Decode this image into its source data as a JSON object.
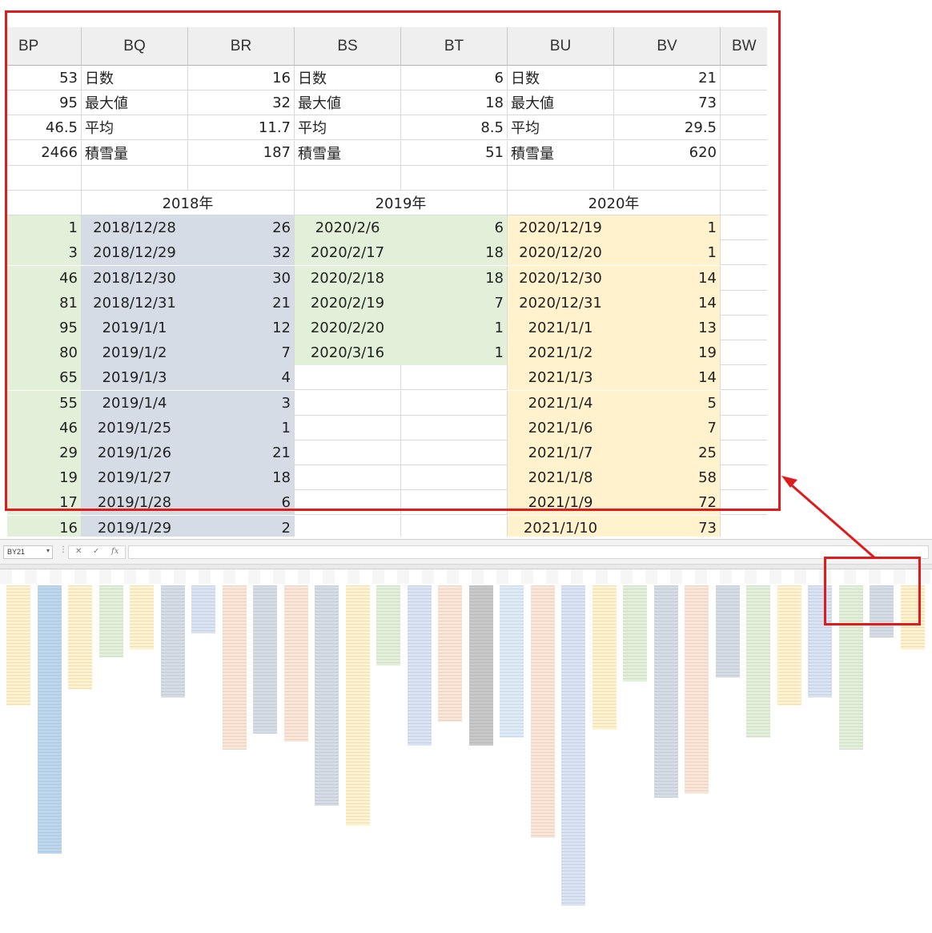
{
  "zoom_grid": {
    "columns": [
      "BP",
      "BQ",
      "BR",
      "BS",
      "BT",
      "BU",
      "BV",
      "BW"
    ],
    "summary_rows": [
      [
        "53",
        "日数",
        "16",
        "日数",
        "6",
        "日数",
        "21"
      ],
      [
        "95",
        "最大値",
        "32",
        "最大値",
        "18",
        "最大値",
        "73"
      ],
      [
        "46.5",
        "平均",
        "11.7",
        "平均",
        "8.5",
        "平均",
        "29.5"
      ],
      [
        "2466",
        "積雪量",
        "187",
        "積雪量",
        "51",
        "積雪量",
        "620"
      ]
    ],
    "year_headers": [
      "2018年",
      "2019年",
      "2020年"
    ],
    "data_rows": [
      [
        "1",
        "2018/12/28",
        "26",
        "2020/2/6",
        "6",
        "2020/12/19",
        "1"
      ],
      [
        "3",
        "2018/12/29",
        "32",
        "2020/2/17",
        "18",
        "2020/12/20",
        "1"
      ],
      [
        "46",
        "2018/12/30",
        "30",
        "2020/2/18",
        "18",
        "2020/12/30",
        "14"
      ],
      [
        "81",
        "2018/12/31",
        "21",
        "2020/2/19",
        "7",
        "2020/12/31",
        "14"
      ],
      [
        "95",
        "2019/1/1",
        "12",
        "2020/2/20",
        "1",
        "2021/1/1",
        "13"
      ],
      [
        "80",
        "2019/1/2",
        "7",
        "2020/3/16",
        "1",
        "2021/1/2",
        "19"
      ],
      [
        "65",
        "2019/1/3",
        "4",
        "",
        "",
        "2021/1/3",
        "14"
      ],
      [
        "55",
        "2019/1/4",
        "3",
        "",
        "",
        "2021/1/4",
        "5"
      ],
      [
        "46",
        "2019/1/25",
        "1",
        "",
        "",
        "2021/1/6",
        "7"
      ],
      [
        "29",
        "2019/1/26",
        "21",
        "",
        "",
        "2021/1/7",
        "25"
      ],
      [
        "19",
        "2019/1/27",
        "18",
        "",
        "",
        "2021/1/8",
        "58"
      ],
      [
        "17",
        "2019/1/28",
        "6",
        "",
        "",
        "2021/1/9",
        "72"
      ],
      [
        "16",
        "2019/1/29",
        "2",
        "",
        "",
        "2021/1/10",
        "73"
      ]
    ],
    "colors": {
      "green": "#e2efd9",
      "blue_gray": "#d6dce5",
      "yellow": "#fff2cc",
      "header_bg": "#efefef",
      "frame": "#e01b1b"
    }
  },
  "overview": {
    "name_box": "BY21",
    "formula_buttons": [
      "⋮",
      "✕",
      "✓",
      "fx"
    ],
    "strip_colors": [
      "#fff2cc",
      "#bdd7ee",
      "#fff2cc",
      "#e2efd9",
      "#fff2cc",
      "#d6dce5",
      "#dae3f3",
      "#fbe5d6",
      "#d6dce5",
      "#fbe5d6",
      "#d6dce5",
      "#fff2cc",
      "#e2efd9",
      "#dae3f3",
      "#fbe5d6",
      "#c9c9c9",
      "#ddebf7",
      "#fbe5d6",
      "#dae3f3",
      "#fff2cc",
      "#e2efd9",
      "#d6dce5",
      "#fbe5d6",
      "#d6dce5",
      "#e2efd9",
      "#fff2cc",
      "#dae3f3",
      "#e2efd9",
      "#d6dce5",
      "#fff2cc"
    ],
    "strip_lengths": [
      150,
      335,
      130,
      90,
      80,
      140,
      60,
      205,
      185,
      195,
      275,
      300,
      100,
      200,
      170,
      200,
      190,
      315,
      400,
      180,
      120,
      265,
      260,
      115,
      190,
      150,
      140,
      205,
      65,
      80
    ]
  }
}
